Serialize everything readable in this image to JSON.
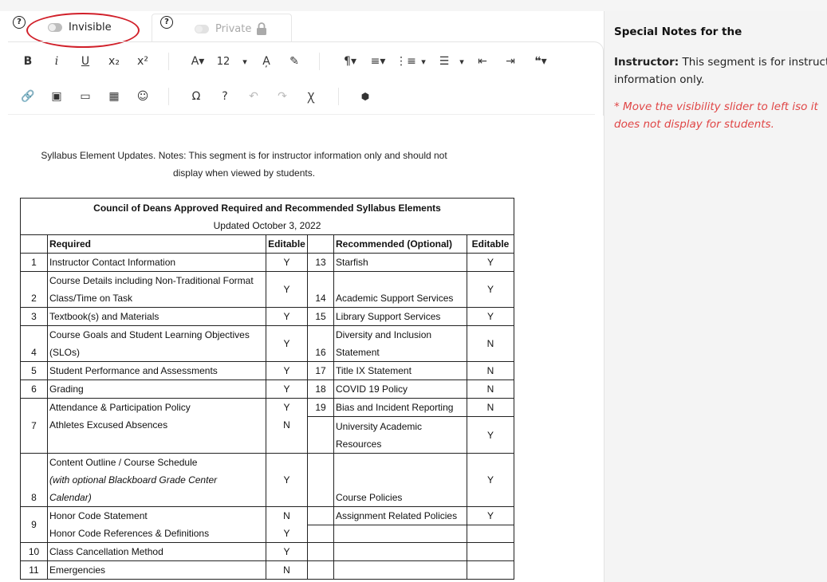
{
  "header": {
    "invisible_label": "Invisible",
    "private_label": "Private",
    "help_glyph": "?"
  },
  "toolbar": {
    "row1": [
      "B",
      "i",
      "U",
      "x₂",
      "x²",
      "A▾",
      "12",
      "▾",
      "A̦",
      "✎",
      "¶▾",
      "≡▾",
      "⋮≡",
      "▾",
      "☰",
      "▾",
      "⇤",
      "⇥",
      "❝▾"
    ],
    "font_size": "12",
    "row2": [
      "🔗",
      "▣",
      "▭",
      "▦",
      "☺",
      "Ω",
      "?",
      "↶",
      "↷",
      "Ꭓ",
      "⬢"
    ]
  },
  "editor": {
    "intro_line1": "Syllabus Element Updates. Notes: This segment is for instructor information only and should not",
    "intro_line2": "display when viewed by students.",
    "table": {
      "title": "Council of Deans Approved Required and Recommended Syllabus Elements",
      "updated": "Updated October 3, 2022",
      "h_required": "Required",
      "h_editable": "Editable",
      "h_recommended": "Recommended (Optional)",
      "h_editable2": "Editable",
      "r1": {
        "n": "1",
        "a": "Instructor Contact Information",
        "e": "Y",
        "n2": "13",
        "b": "Starfish",
        "e2": "Y"
      },
      "r2": {
        "n": "2",
        "a1": "Course Details including Non-Traditional Format",
        "a2": "Class/Time on Task",
        "e": "Y",
        "n2": "14",
        "b": "Academic Support Services",
        "e2": "Y"
      },
      "r3": {
        "n": "3",
        "a": "Textbook(s) and Materials",
        "e": "Y",
        "n2": "15",
        "b": "Library Support Services",
        "e2": "Y"
      },
      "r4": {
        "n": "4",
        "a1": "Course Goals and Student Learning Objectives",
        "a2": "(SLOs)",
        "e": "Y",
        "n2": "16",
        "b1": "Diversity and Inclusion",
        "b2": "Statement",
        "e2": "N"
      },
      "r5": {
        "n": "5",
        "a": "Student Performance and Assessments",
        "e": "Y",
        "n2": "17",
        "b": "Title IX Statement",
        "e2": "N"
      },
      "r6": {
        "n": "6",
        "a": "Grading",
        "e": "Y",
        "n2": "18",
        "b": "COVID 19 Policy",
        "e2": "N"
      },
      "r7": {
        "n": "7",
        "a1": "Attendance & Participation Policy",
        "a2": " Athletes Excused Absences",
        "e1": "Y",
        "e2": "N",
        "n2": "19",
        "b": "Bias and Incident Reporting",
        "e2b": "N",
        "b2a": "University Academic",
        "b2b": "Resources",
        "e3": "Y"
      },
      "r8": {
        "n": "8",
        "a1": "Content Outline / Course Schedule",
        "a2": "(with optional Blackboard Grade Center",
        "a3": "Calendar)",
        "e": "Y",
        "b": "Course Policies",
        "e2": "Y"
      },
      "r9": {
        "n": "9",
        "a1": "Honor Code Statement",
        "a2": " Honor Code References & Definitions",
        "e1": "N",
        "e2": "Y",
        "b": "Assignment  Related Policies",
        "e3": "Y"
      },
      "r10": {
        "n": "10",
        "a": "Class Cancellation Method",
        "e": "Y"
      },
      "r11": {
        "n": "11",
        "a": "Emergencies",
        "e": "N"
      }
    }
  },
  "side_panel": {
    "title": "Special Notes for the",
    "bold_lead": "Instructor:",
    "text1": " This segment is for instructor",
    "text2": "information only.",
    "note1": "* Move the visibility slider to left iso it",
    "note2": "does not display for students."
  },
  "colors": {
    "annotation": "#d1202a",
    "note": "#e04646"
  }
}
